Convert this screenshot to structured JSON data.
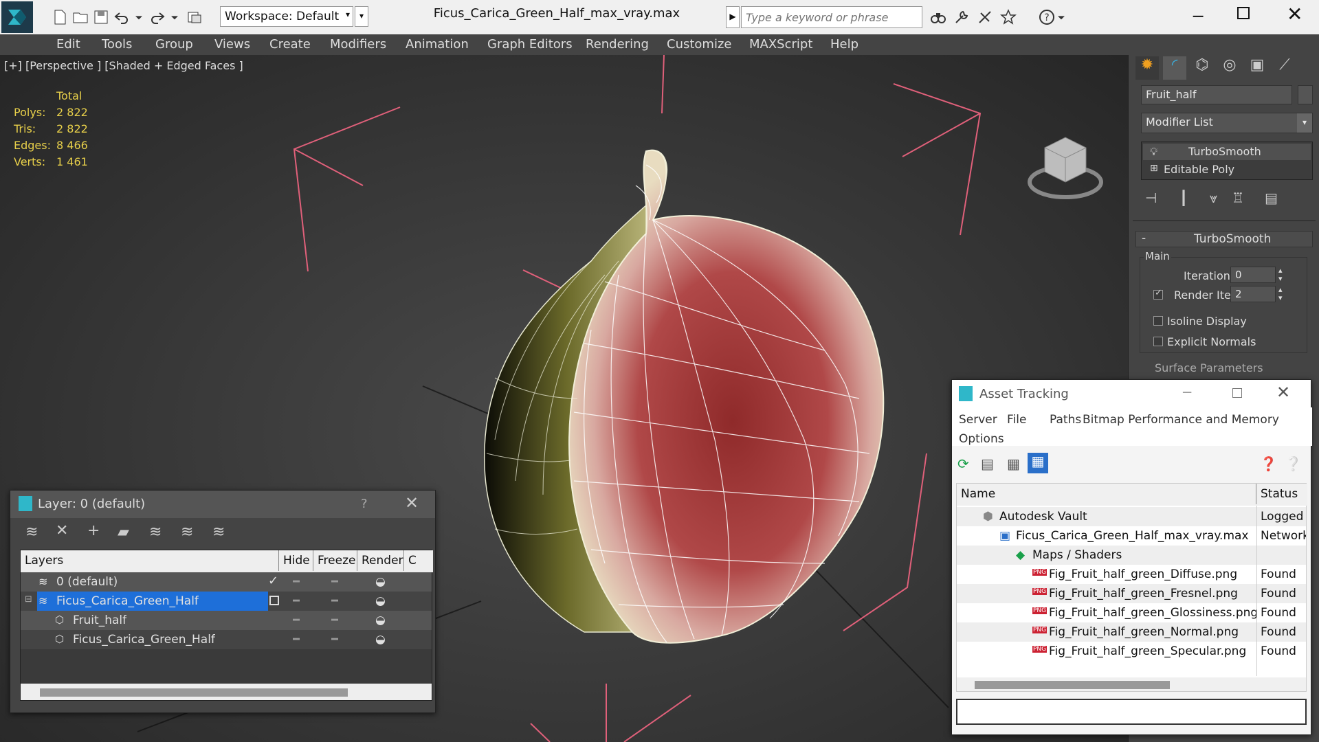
{
  "window": {
    "title": "Ficus_Carica_Green_Half_max_vray.max",
    "workspace": "Workspace: Default",
    "search_placeholder": "Type a keyword or phrase"
  },
  "menu": [
    "Edit",
    "Tools",
    "Group",
    "Views",
    "Create",
    "Modifiers",
    "Animation",
    "Graph Editors",
    "Rendering",
    "Customize",
    "MAXScript",
    "Help"
  ],
  "viewport": {
    "label": "[+] [Perspective ] [Shaded + Edged Faces ]",
    "stats": {
      "header": "Total",
      "rows": [
        {
          "label": "Polys:",
          "value": "2 822"
        },
        {
          "label": "Tris:",
          "value": "2 822"
        },
        {
          "label": "Edges:",
          "value": "8 466"
        },
        {
          "label": "Verts:",
          "value": "1 461"
        }
      ]
    }
  },
  "command_panel": {
    "object_name": "Fruit_half",
    "modifier_list": "Modifier List",
    "stack": [
      "TurboSmooth",
      "Editable Poly"
    ],
    "rollout_title": "TurboSmooth",
    "group_main": "Main",
    "iterations_label": "Iterations:",
    "iterations_value": "0",
    "render_iters_label": "Render Iters:",
    "render_iters_value": "2",
    "isoline_label": "Isoline Display",
    "explicit_normals_label": "Explicit Normals",
    "surface_params_label": "Surface Parameters"
  },
  "layer_window": {
    "title": "Layer: 0 (default)",
    "help": "?",
    "columns": [
      "Layers",
      "Hide",
      "Freeze",
      "Render",
      "C"
    ],
    "rows": [
      {
        "name": "0 (default)",
        "indent": 0
      },
      {
        "name": "Ficus_Carica_Green_Half",
        "indent": 0
      },
      {
        "name": "Fruit_half",
        "indent": 1
      },
      {
        "name": "Ficus_Carica_Green_Half",
        "indent": 1
      }
    ]
  },
  "asset_window": {
    "title": "Asset Tracking",
    "menu": [
      "Server",
      "File",
      "Paths",
      "Bitmap Performance and Memory",
      "Options"
    ],
    "columns": [
      "Name",
      "Status"
    ],
    "rows": [
      {
        "name": "Autodesk Vault",
        "status": "Logged"
      },
      {
        "name": "Ficus_Carica_Green_Half_max_vray.max",
        "status": "Network"
      },
      {
        "name": "Maps / Shaders",
        "status": ""
      },
      {
        "name": "Fig_Fruit_half_green_Diffuse.png",
        "status": "Found"
      },
      {
        "name": "Fig_Fruit_half_green_Fresnel.png",
        "status": "Found"
      },
      {
        "name": "Fig_Fruit_half_green_Glossiness.png",
        "status": "Found"
      },
      {
        "name": "Fig_Fruit_half_green_Normal.png",
        "status": "Found"
      },
      {
        "name": "Fig_Fruit_half_green_Specular.png",
        "status": "Found"
      }
    ]
  },
  "colors": {
    "selection": "#1e6fd9",
    "stats_text": "#e8d04a",
    "gizmo": "#e0607a"
  }
}
